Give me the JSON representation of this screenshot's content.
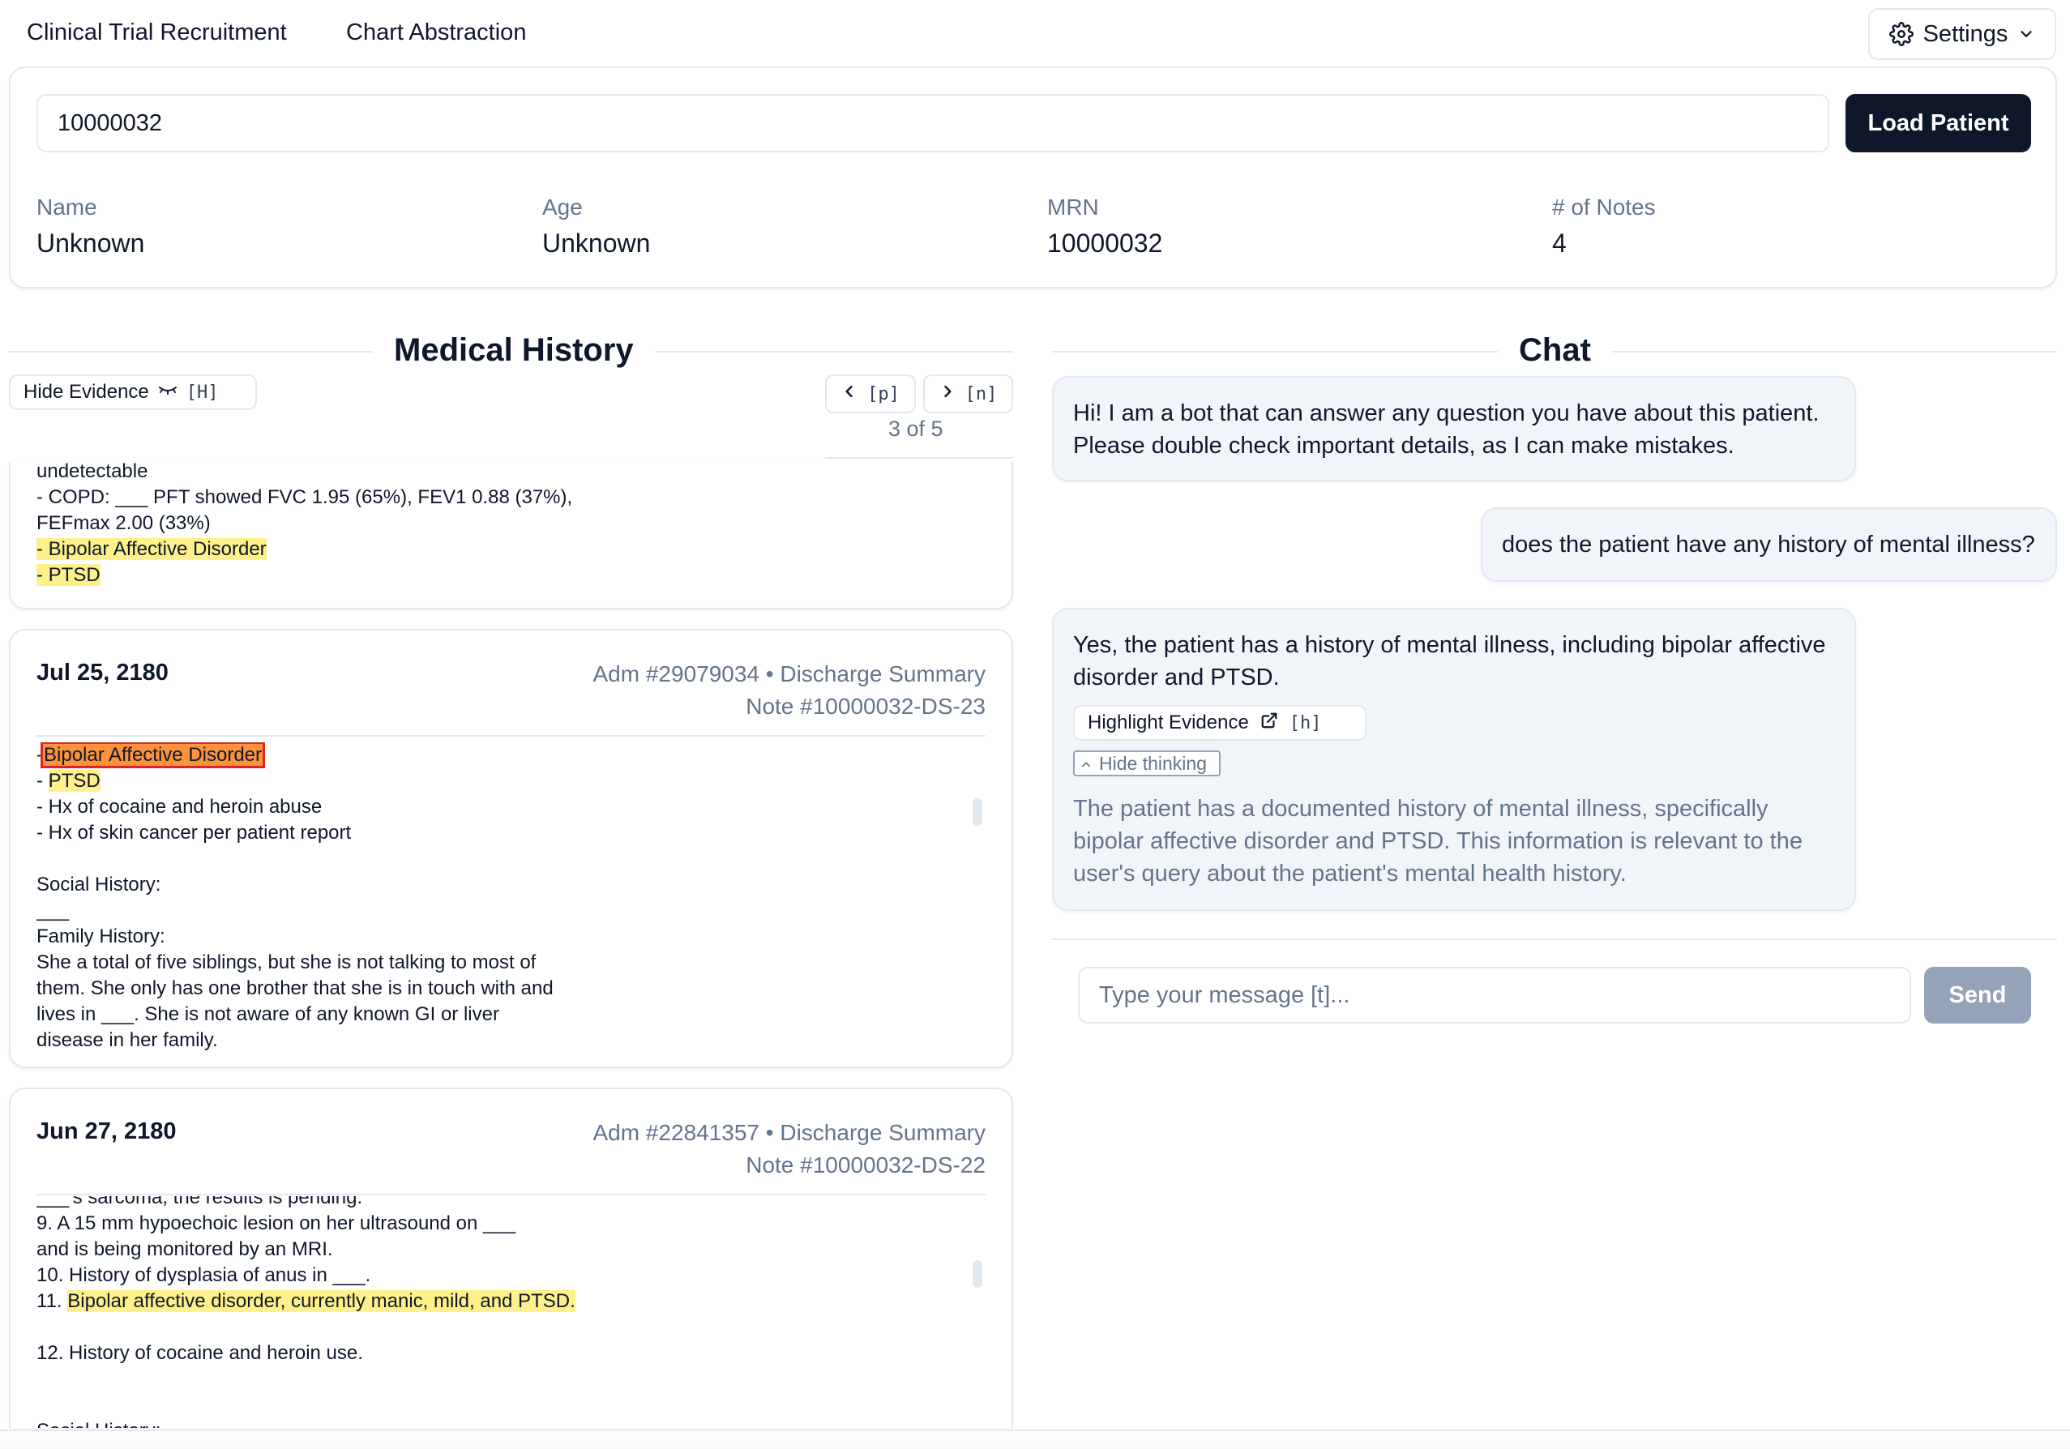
{
  "nav": {
    "links": [
      "Clinical Trial Recruitment",
      "Chart Abstraction"
    ],
    "settings_label": "Settings"
  },
  "patient": {
    "id_input_value": "10000032",
    "load_button": "Load Patient",
    "fields": [
      {
        "label": "Name",
        "value": "Unknown"
      },
      {
        "label": "Age",
        "value": "Unknown"
      },
      {
        "label": "MRN",
        "value": "10000032"
      },
      {
        "label": "# of Notes",
        "value": "4"
      }
    ]
  },
  "history": {
    "title": "Medical History",
    "toggle_label": "Hide Evidence",
    "toggle_shortcut": "[H]",
    "prev_shortcut": "[p]",
    "next_shortcut": "[n]",
    "pager_text": "3 of 5",
    "notes": [
      {
        "lines": [
          [
            {
              "t": "undetectable"
            }
          ],
          [
            {
              "t": "- COPD: ___ PFT showed FVC 1.95 (65%), FEV1 0.88 (37%),"
            }
          ],
          [
            {
              "t": "FEFmax 2.00 (33%)"
            }
          ],
          [
            {
              "t": "- Bipolar Affective Disorder",
              "h": "hl"
            }
          ],
          [
            {
              "t": "- PTSD",
              "h": "hl"
            }
          ]
        ]
      },
      {
        "date": "Jul 25, 2180",
        "meta1": "Adm #29079034 • Discharge Summary",
        "meta2": "Note #10000032-DS-23",
        "lines": [
          [
            {
              "t": "-"
            },
            {
              "t": "Bipolar Affective Disorder",
              "h": "hl-active"
            }
          ],
          [
            {
              "t": "- "
            },
            {
              "t": "PTSD",
              "h": "hl"
            }
          ],
          [
            {
              "t": "- Hx of cocaine and heroin abuse"
            }
          ],
          [
            {
              "t": "- Hx of skin cancer per patient report"
            }
          ],
          [
            {
              "t": ""
            }
          ],
          [
            {
              "t": "Social History:"
            }
          ],
          [
            {
              "t": "___"
            }
          ],
          [
            {
              "t": "Family History:"
            }
          ],
          [
            {
              "t": "She a total of five siblings, but she is not talking to most of"
            }
          ],
          [
            {
              "t": "them. She only has one brother that she is in touch with and"
            }
          ],
          [
            {
              "t": "lives in ___. She is not aware of any known GI or liver"
            }
          ],
          [
            {
              "t": "disease in her family."
            }
          ]
        ]
      },
      {
        "date": "Jun 27, 2180",
        "meta1": "Adm #22841357 • Discharge Summary",
        "meta2": "Note #10000032-DS-22",
        "lines": [
          [
            {
              "t": "___'s sarcoma, the results is pending."
            }
          ],
          [
            {
              "t": "9. A 15 mm hypoechoic lesion on her ultrasound on ___"
            }
          ],
          [
            {
              "t": "and is being monitored by an MRI."
            }
          ],
          [
            {
              "t": "10. History of dysplasia of anus in ___."
            }
          ],
          [
            {
              "t": "11. "
            },
            {
              "t": "Bipolar affective disorder, currently manic, mild, and PTSD.",
              "h": "hl"
            }
          ],
          [
            {
              "t": ""
            }
          ],
          [
            {
              "t": "12. History of cocaine and heroin use."
            }
          ],
          [
            {
              "t": ""
            }
          ],
          [
            {
              "t": ""
            }
          ],
          [
            {
              "t": "Social History:"
            }
          ]
        ]
      }
    ]
  },
  "chat": {
    "title": "Chat",
    "bot_greeting": "Hi! I am a bot that can answer any question you have about this patient. Please double check important details, as I can make mistakes.",
    "user_message": "does the patient have any history of mental illness?",
    "bot_answer": "Yes, the patient has a history of mental illness, including bipolar affective disorder and PTSD.",
    "evidence_button": "Highlight Evidence",
    "evidence_shortcut": "[h]",
    "thinking_toggle": "Hide thinking",
    "thinking_text": "The patient has a documented history of mental illness, specifically bipolar affective disorder and PTSD. This information is relevant to the user's query about the patient's mental health history.",
    "input_placeholder": "Type your message [t]...",
    "send_label": "Send"
  },
  "colors": {
    "highlight": "#fef08a",
    "highlight_active": "#fb923c",
    "highlight_active_border": "#dc2626",
    "primary_dark": "#0f172a",
    "muted_text": "#64748b",
    "bubble_bg": "#f1f5f9",
    "send_disabled": "#94a3b8"
  },
  "icons": {
    "settings": "gear-icon",
    "settings_caret": "chevron-down-icon",
    "hide_evidence": "eye-closed-icon",
    "prev": "chevron-left-icon",
    "next": "chevron-right-icon",
    "external": "external-link-icon",
    "thinking_caret": "chevron-up-icon"
  }
}
